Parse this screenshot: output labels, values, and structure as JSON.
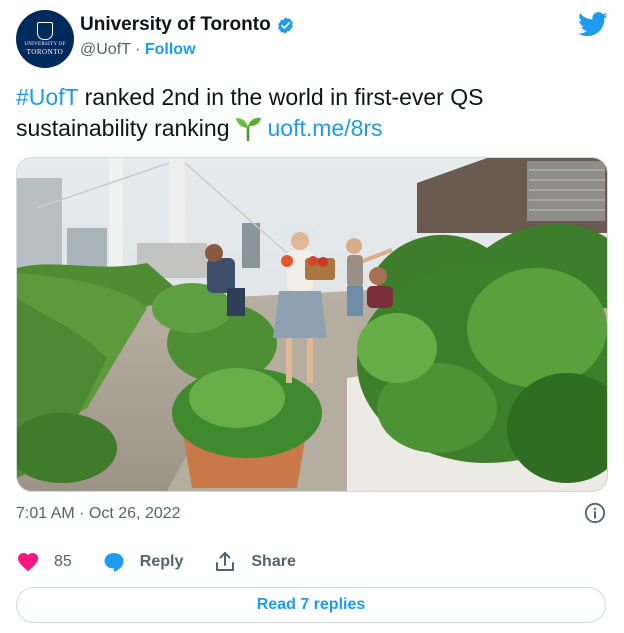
{
  "account": {
    "display_name": "University of Toronto",
    "handle": "@UofT",
    "separator": "·",
    "follow_label": "Follow",
    "avatar_text_top": "UNIVERSITY OF",
    "avatar_text_bottom": "TORONTO",
    "verified": true
  },
  "tweet": {
    "hashtag": "#UofT",
    "text": " ranked 2nd in the world in first-ever QS sustainability ranking",
    "link": "uoft.me/8rs",
    "emoji": "seedling-icon"
  },
  "meta": {
    "timestamp": "7:01 AM · Oct 26, 2022"
  },
  "actions": {
    "like_count": "85",
    "reply_label": "Reply",
    "share_label": "Share",
    "read_replies_label": "Read 7 replies"
  },
  "colors": {
    "accent": "#1d9bf0",
    "like": "#f91880",
    "muted": "#536471",
    "brand_avatar": "#002a5c"
  },
  "icons": [
    "verified-badge-icon",
    "twitter-bird-icon",
    "seedling-icon",
    "info-icon",
    "heart-icon",
    "reply-bubble-icon",
    "share-icon"
  ]
}
